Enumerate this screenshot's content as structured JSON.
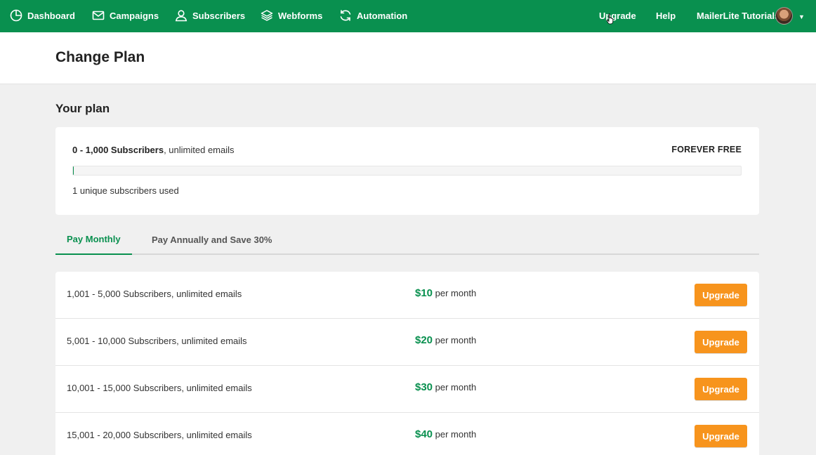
{
  "nav": {
    "items": [
      {
        "label": "Dashboard",
        "icon": "dashboard-icon"
      },
      {
        "label": "Campaigns",
        "icon": "mail-icon"
      },
      {
        "label": "Subscribers",
        "icon": "user-icon"
      },
      {
        "label": "Webforms",
        "icon": "layers-icon"
      },
      {
        "label": "Automation",
        "icon": "refresh-icon"
      }
    ],
    "upgrade_label": "Upgrade",
    "help_label": "Help",
    "account_name": "MailerLite Tutorials"
  },
  "header": {
    "title": "Change Plan"
  },
  "your_plan": {
    "section_title": "Your plan",
    "range": "0 - 1,000 Subscribers",
    "suffix": ", unlimited emails",
    "tag": "FOREVER FREE",
    "usage_fraction": 0.001,
    "usage_text": "1 unique subscribers used"
  },
  "tabs": [
    {
      "label": "Pay Monthly",
      "active": true
    },
    {
      "label": "Pay Annually and Save 30%",
      "active": false
    }
  ],
  "tiers": [
    {
      "range": "1,001 - 5,000 Subscribers",
      "suffix": ", unlimited emails",
      "price": "$10",
      "period": "per month",
      "button": "Upgrade"
    },
    {
      "range": "5,001 - 10,000 Subscribers",
      "suffix": ", unlimited emails",
      "price": "$20",
      "period": "per month",
      "button": "Upgrade"
    },
    {
      "range": "10,001 - 15,000 Subscribers",
      "suffix": ", unlimited emails",
      "price": "$30",
      "period": "per month",
      "button": "Upgrade"
    },
    {
      "range": "15,001 - 20,000 Subscribers",
      "suffix": ", unlimited emails",
      "price": "$40",
      "period": "per month",
      "button": "Upgrade"
    }
  ],
  "colors": {
    "brand": "#09904f",
    "button": "#f7941d",
    "background": "#f0f0f0"
  }
}
